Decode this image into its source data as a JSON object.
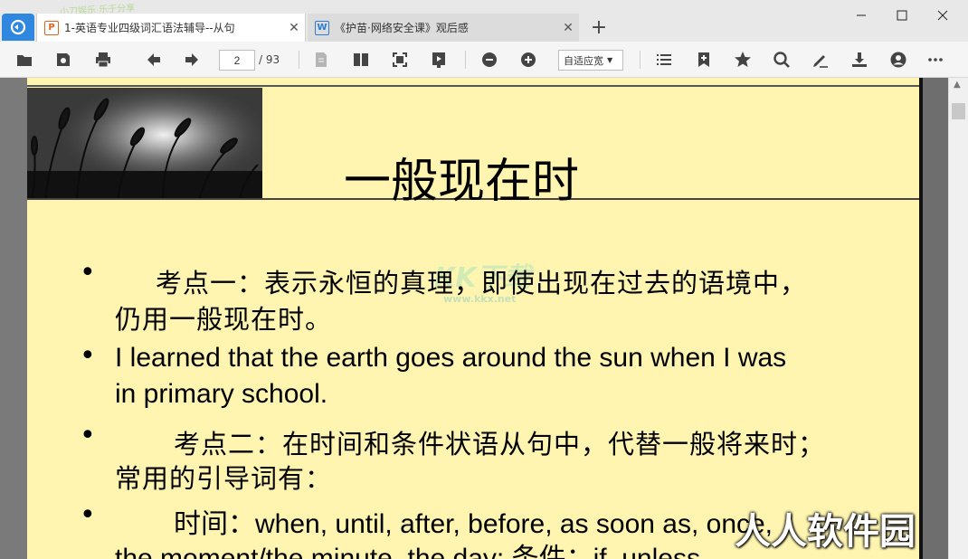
{
  "tabs": [
    {
      "label": "1-英语专业四级词汇语法辅导--从句",
      "type_icon": "ppt-icon",
      "active": true
    },
    {
      "label": "《护苗·网络安全课》观后感",
      "type_icon": "word-icon",
      "active": false
    }
  ],
  "tab_watermark": "小刀娱乐  乐于分享",
  "window_controls": {
    "minimize": "—",
    "maximize": "☐",
    "close": "✕"
  },
  "toolbar": {
    "page_current": "2",
    "page_total": "/ 93",
    "zoom_mode": "自适应宽"
  },
  "slide": {
    "title": "一般现在时",
    "bullets": [
      {
        "line1": "考点一：表示永恒的真理，即使出现在过去的语境中，",
        "line2": "仍用一般现在时。"
      },
      {
        "line1": "I learned that the earth goes around the sun when I was",
        "line2": "in primary school."
      },
      {
        "line1": "考点二：在时间和条件状语从句中，代替一般将来时；",
        "line2": "常用的引导词有："
      },
      {
        "line1": "时间：when, until, after, before, as soon as, once,",
        "line2": "the moment/the minute, the day; 条件：if, unless,"
      }
    ],
    "watermark_text": "KK下载",
    "watermark_url": "www.kkx.net"
  },
  "corner_watermark": "人人软件园",
  "accent_color": "#2f87e0",
  "slide_bg_color": "#fff5b1"
}
